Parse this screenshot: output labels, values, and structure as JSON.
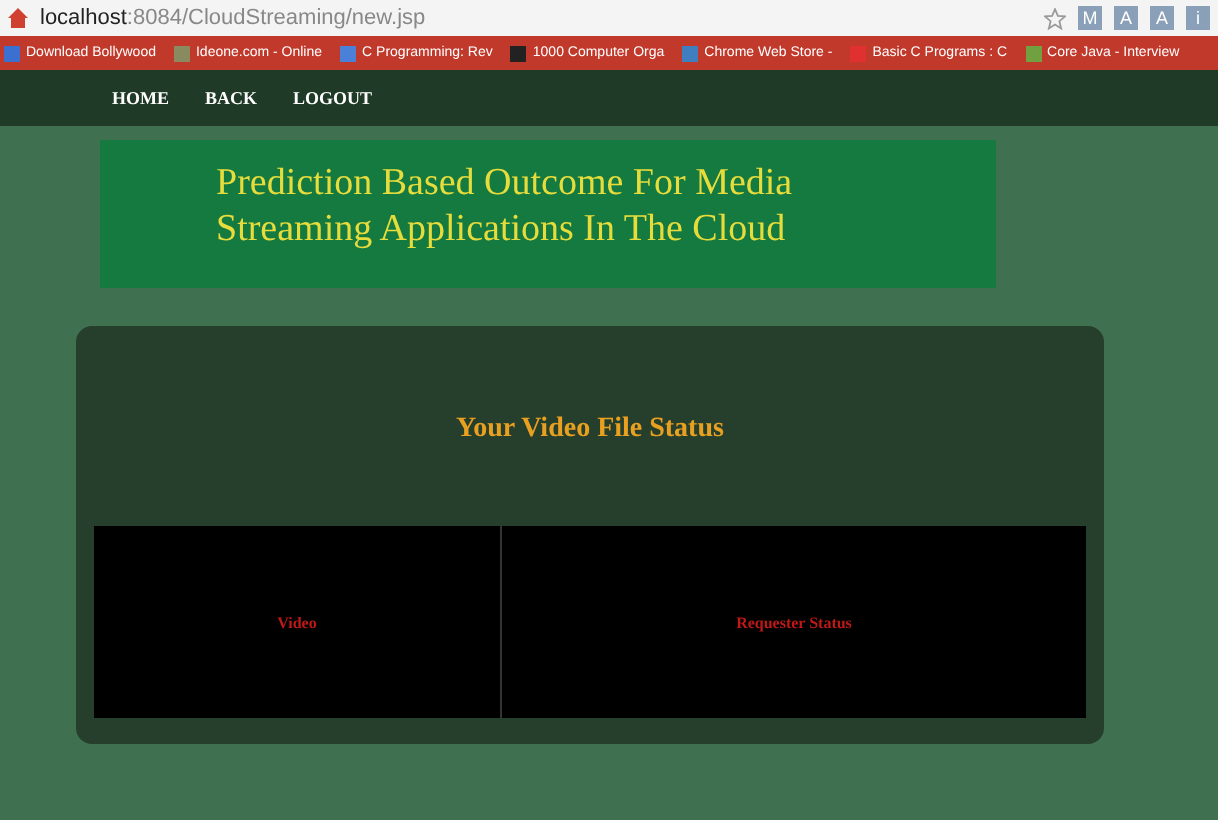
{
  "browser": {
    "url_host": "localhost",
    "url_rest": ":8084/CloudStreaming/new.jsp",
    "extensions": [
      "M",
      "A",
      "A",
      "i"
    ],
    "bookmarks": [
      {
        "label": "Download Bollywood",
        "color": "#3b6fd0"
      },
      {
        "label": "Ideone.com - Online",
        "color": "#8a8a60"
      },
      {
        "label": "C Programming: Rev",
        "color": "#4a80d8"
      },
      {
        "label": "1000 Computer Orga",
        "color": "#222222"
      },
      {
        "label": "Chrome Web Store -",
        "color": "#3f7fc0"
      },
      {
        "label": "Basic C Programs : C",
        "color": "#e03030"
      },
      {
        "label": "Core Java - Interview",
        "color": "#70a040"
      }
    ]
  },
  "nav": [
    "HOME",
    "BACK",
    "LOGOUT"
  ],
  "header": {
    "title_lines": [
      "Prediction Based Outcome For Media",
      "Streaming Applications In The Cloud"
    ]
  },
  "status_panel": {
    "title": "Your Video File Status",
    "table": {
      "columns": [
        "Video",
        "Requester Status"
      ]
    }
  }
}
